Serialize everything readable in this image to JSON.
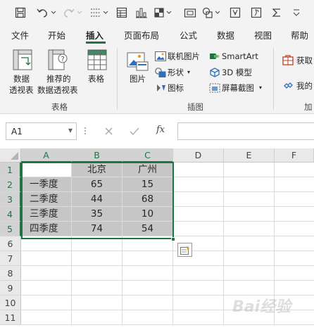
{
  "tabs": [
    "文件",
    "开始",
    "插入",
    "页面布局",
    "公式",
    "数据",
    "视图",
    "帮助"
  ],
  "active_tab": "插入",
  "ribbon": {
    "tables_group": {
      "label": "表格",
      "pivot_table": [
        "数据",
        "透视表"
      ],
      "recommended_pivot": [
        "推荐的",
        "数据透视表"
      ],
      "table": "表格"
    },
    "illustrations_group": {
      "label": "插图",
      "pictures": "图片",
      "online_pictures": "联机图片",
      "shapes": "形状",
      "icons": "图标",
      "smartart": "SmartArt",
      "model3d": "3D 模型",
      "screenshot": "屏幕截图"
    },
    "addins_group": {
      "label": "加",
      "get_addins": "获取",
      "my_addins": "我的"
    }
  },
  "formula_bar": {
    "name_box": "A1",
    "fx": "fx",
    "formula": ""
  },
  "grid": {
    "columns": [
      "A",
      "B",
      "C",
      "D",
      "E",
      "F"
    ],
    "rows": [
      "1",
      "2",
      "3",
      "4",
      "5",
      "6",
      "7",
      "8",
      "9",
      "10",
      "11"
    ],
    "table_header": [
      "",
      "北京",
      "广州"
    ],
    "table_rows": [
      [
        "一季度",
        "65",
        "15"
      ],
      [
        "二季度",
        "44",
        "68"
      ],
      [
        "三季度",
        "35",
        "10"
      ],
      [
        "四季度",
        "74",
        "54"
      ]
    ]
  },
  "watermark": "Bai经验",
  "colors": {
    "accent": "#217346",
    "ribbon_bg": "#f3f3f3",
    "selection_fill": "#c6c6c6"
  }
}
